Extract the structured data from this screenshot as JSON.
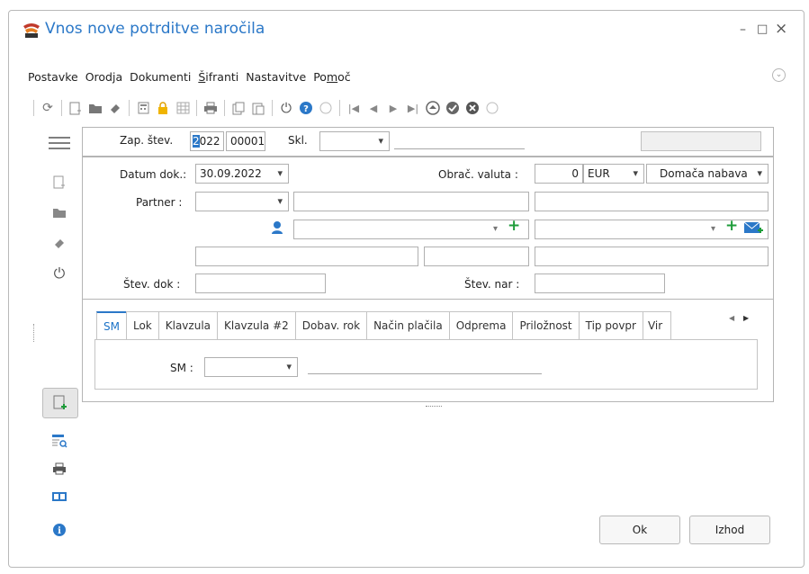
{
  "window": {
    "title": "Vnos nove potrditve naročila",
    "minimize_glyph": "–",
    "maximize_glyph": "□",
    "close_glyph": "×"
  },
  "menu": [
    "Postavke",
    "Orodja",
    "Dokumenti",
    "Šifranti",
    "Nastavitve",
    "Pomoč"
  ],
  "toolbar_icons": [
    "refresh-icon",
    "new-doc-icon",
    "open-folder-icon",
    "eraser-icon",
    "calculator-icon",
    "lock-icon",
    "grid-icon",
    "print-icon",
    "copy-icon",
    "paste-icon",
    "power-icon",
    "help-icon",
    "collapse-icon",
    "first-record-icon",
    "prev-record-icon",
    "next-record-icon",
    "last-record-icon",
    "upload-icon",
    "confirm-icon",
    "cancel-icon",
    "collapse-icon-2"
  ],
  "header": {
    "zap_stev_label": "Zap. štev.",
    "year": "2022",
    "number": "00001",
    "skl_label": "Skl.",
    "skl_value": ""
  },
  "form": {
    "datum_label": "Datum dok.:",
    "datum_value": "30.09.2022",
    "obrac_label": "Obrač. valuta :",
    "obrac_amount": "0",
    "currency": "EUR",
    "nabava": "Domača nabava",
    "partner_label": "Partner :",
    "partner_value": "",
    "stev_dok_label": "Štev. dok :",
    "stev_dok_value": "",
    "stev_nar_label": "Štev. nar :",
    "stev_nar_value": ""
  },
  "tabs": [
    "SM",
    "Lok",
    "Klavzula",
    "Klavzula #2",
    "Dobav. rok",
    "Način plačila",
    "Odprema",
    "Priložnost",
    "Tip povpr",
    "Vir"
  ],
  "tab_content": {
    "sm_label": "SM :",
    "sm_value": ""
  },
  "buttons": {
    "ok": "Ok",
    "exit": "Izhod"
  },
  "colors": {
    "accent": "#2b78c8",
    "green": "#1e9c3a"
  }
}
